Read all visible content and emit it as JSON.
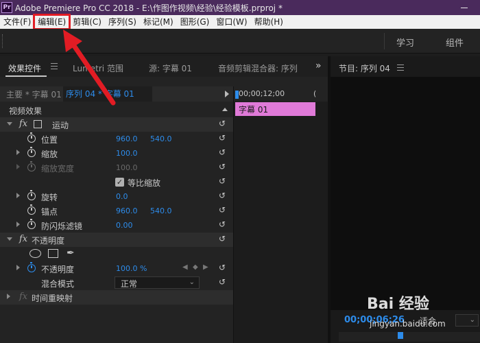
{
  "titlebar": {
    "logo": "Pr",
    "title": "Adobe Premiere Pro CC 2018 - E:\\作图作视频\\经验\\经验模板.prproj *"
  },
  "menu": [
    {
      "label": "文件(F)"
    },
    {
      "label": "编辑(E)"
    },
    {
      "label": "剪辑(C)"
    },
    {
      "label": "序列(S)"
    },
    {
      "label": "标记(M)"
    },
    {
      "label": "图形(G)"
    },
    {
      "label": "窗口(W)"
    },
    {
      "label": "帮助(H)"
    }
  ],
  "workspace": {
    "tabs": [
      "学习",
      "组件"
    ]
  },
  "panel_tabs": {
    "effect_controls": "效果控件",
    "lumetri": "Lumetri 范围",
    "source": "源: 字幕 01",
    "audio_mixer": "音频剪辑混合器: 序列",
    "more": "»"
  },
  "source_row": {
    "main": "主要 * 字幕 01",
    "sequence": "序列 04 * 字幕 01"
  },
  "effects": {
    "header": "视频效果",
    "motion": {
      "label": "运动",
      "position": {
        "label": "位置",
        "x": "960.0",
        "y": "540.0"
      },
      "scale": {
        "label": "缩放",
        "value": "100.0"
      },
      "scale_width": {
        "label": "缩放宽度",
        "value": "100.0"
      },
      "uniform_scale": {
        "label": "等比缩放",
        "checked": true
      },
      "rotation": {
        "label": "旋转",
        "value": "0.0"
      },
      "anchor": {
        "label": "锚点",
        "x": "960.0",
        "y": "540.0"
      },
      "anti_flicker": {
        "label": "防闪烁滤镜",
        "value": "0.00"
      }
    },
    "opacity": {
      "label": "不透明度",
      "opacity_value": {
        "label": "不透明度",
        "value": "100.0 %"
      },
      "blend_mode": {
        "label": "混合模式",
        "value": "正常"
      }
    },
    "time_remap": {
      "label": "时间重映射"
    }
  },
  "mini_timeline": {
    "timecode": "00;00;12;00",
    "paren": "(",
    "clip_label": "字幕 01",
    "clip_color": "#e07ad8"
  },
  "program": {
    "title": "节目: 序列 04",
    "timecode": "00;00;06;26",
    "fit": "适合"
  },
  "watermark": {
    "logo": "Bai 经验",
    "url": "jingyan.baidu.com"
  },
  "colors": {
    "accent": "#2d8ceb",
    "annotation": "#e21c24",
    "titlebar": "#4a2a5c"
  }
}
